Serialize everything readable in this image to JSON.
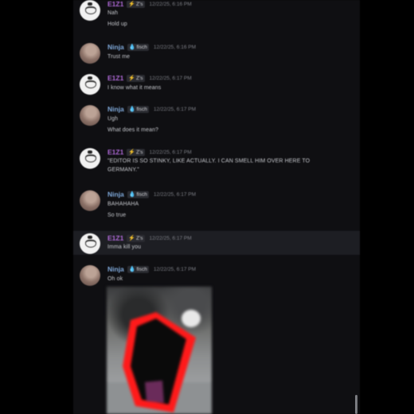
{
  "messages": [
    {
      "user": "E1Z1",
      "tag": "Z's",
      "tag_icon": "bolt-icon",
      "time": "12/22/25, 6:16 PM",
      "lines": [
        "Nah",
        "Hold up"
      ],
      "avatar": "white"
    },
    {
      "user": "Ninja",
      "tag": "fisch",
      "tag_icon": "drop-icon",
      "time": "12/22/25, 6:16 PM",
      "lines": [
        "Trust me"
      ],
      "avatar": "brown"
    },
    {
      "user": "E1Z1",
      "tag": "Z's",
      "tag_icon": "bolt-icon",
      "time": "12/22/25, 6:17 PM",
      "lines": [
        "I know what it means"
      ],
      "avatar": "white"
    },
    {
      "user": "Ninja",
      "tag": "fisch",
      "tag_icon": "drop-icon",
      "time": "12/22/25, 6:17 PM",
      "lines": [
        "Ugh",
        "What does it mean?"
      ],
      "avatar": "brown"
    },
    {
      "user": "E1Z1",
      "tag": "Z's",
      "tag_icon": "bolt-icon",
      "time": "12/22/25, 6:17 PM",
      "lines": [
        "\"EDITOR IS SO STINKY, LIKE ACTUALLY. I CAN SMELL HIM OVER HERE TO GERMANY.\""
      ],
      "avatar": "white"
    },
    {
      "user": "Ninja",
      "tag": "fisch",
      "tag_icon": "drop-icon",
      "time": "12/22/25, 6:17 PM",
      "lines": [
        "BAHAHAHA",
        "So true"
      ],
      "avatar": "brown"
    },
    {
      "user": "E1Z1",
      "tag": "Z's",
      "tag_icon": "bolt-icon",
      "time": "12/22/25, 6:17 PM",
      "lines": [
        "Imma kill you"
      ],
      "avatar": "white"
    },
    {
      "user": "Ninja",
      "tag": "fisch",
      "tag_icon": "drop-icon",
      "time": "12/22/25, 6:17 PM",
      "lines": [
        "Oh ok"
      ],
      "avatar": "brown"
    }
  ],
  "attachment": {
    "outline_color": "#ff1a1a"
  },
  "colors": {
    "background": "#0f0f12",
    "highlight": "#1d1e23",
    "e1z1": "#b06ad8",
    "ninja": "#7fa9da"
  }
}
